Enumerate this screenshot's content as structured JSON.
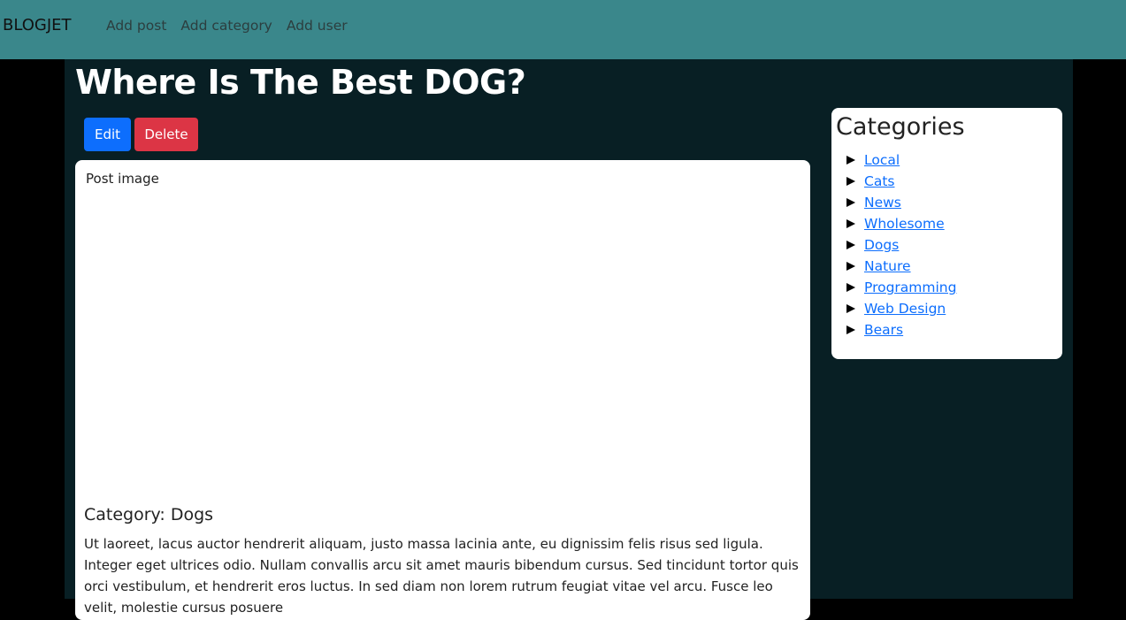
{
  "navbar": {
    "brand": "BLOGJET",
    "links": [
      "Add post",
      "Add category",
      "Add user"
    ],
    "background": "#3a878b"
  },
  "post": {
    "title": "Where Is The Best DOG?",
    "edit_label": "Edit",
    "delete_label": "Delete",
    "image_alt": "Post image",
    "category_heading": "Category: Dogs",
    "body": "Ut laoreet, lacus auctor hendrerit aliquam, justo massa lacinia ante, eu dignissim felis risus sed ligula. Integer eget ultrices odio. Nullam convallis arcu sit amet mauris bibendum cursus. Sed tincidunt tortor quis orci vestibulum, et hendrerit eros luctus. In sed diam non lorem rutrum feugiat vitae vel arcu. Fusce leo velit, molestie cursus posuere"
  },
  "sidebar": {
    "title": "Categories",
    "categories": [
      "Local",
      "Cats",
      "News",
      "Wholesome",
      "Dogs",
      "Nature",
      "Programming",
      "Web Design",
      "Bears"
    ]
  },
  "colors": {
    "edit_button": "#0d6efd",
    "delete_button": "#dc3545",
    "container_bg": "#081f24",
    "link": "#0d6efd"
  },
  "icons": {
    "broken_image": "broken-image-icon",
    "category_bullet": "triangle-right-icon"
  }
}
